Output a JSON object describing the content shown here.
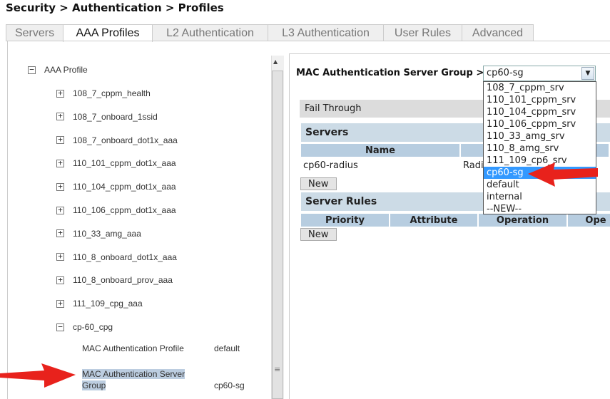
{
  "breadcrumb": "Security > Authentication > Profiles",
  "tabs": [
    {
      "label": "Servers"
    },
    {
      "label": "AAA Profiles",
      "active": true
    },
    {
      "label": "L2 Authentication"
    },
    {
      "label": "L3 Authentication"
    },
    {
      "label": "User Rules"
    },
    {
      "label": "Advanced"
    }
  ],
  "tree": {
    "root": "AAA Profile",
    "items": [
      "108_7_cppm_health",
      "108_7_onboard_1ssid",
      "108_7_onboard_dot1x_aaa",
      "110_101_cppm_dot1x_aaa",
      "110_104_cppm_dot1x_aaa",
      "110_106_cppm_dot1x_aaa",
      "110_33_amg_aaa",
      "110_8_onboard_dot1x_aaa",
      "110_8_onboard_prov_aaa",
      "111_109_cpg_aaa"
    ],
    "expanded": "cp-60_cpg",
    "children": [
      {
        "name": "MAC Authentication Profile",
        "value": "default"
      },
      {
        "name_line1": "MAC Authentication Server",
        "name_line2": "Group",
        "value": "cp60-sg",
        "selected": true
      }
    ]
  },
  "detail": {
    "label": "MAC Authentication Server Group >",
    "select_value": "cp60-sg",
    "options": [
      "108_7_cppm_srv",
      "110_101_cppm_srv",
      "110_104_cppm_srv",
      "110_106_cppm_srv",
      "110_33_amg_srv",
      "110_8_amg_srv",
      "111_109_cp6_srv",
      "cp60-sg",
      "default",
      "internal",
      "--NEW--"
    ],
    "selected_option": "cp60-sg",
    "fail_through": "Fail Through",
    "servers_title": "Servers",
    "servers_columns": [
      "Name"
    ],
    "server_row": {
      "name": "cp60-radius",
      "type_partial": "Radi"
    },
    "new_label": "New",
    "rules_title": "Server Rules",
    "rules_columns": [
      "Priority",
      "Attribute",
      "Operation",
      "Ope"
    ]
  },
  "colors": {
    "highlight": "#3399ff",
    "arrow": "#e8221c"
  }
}
